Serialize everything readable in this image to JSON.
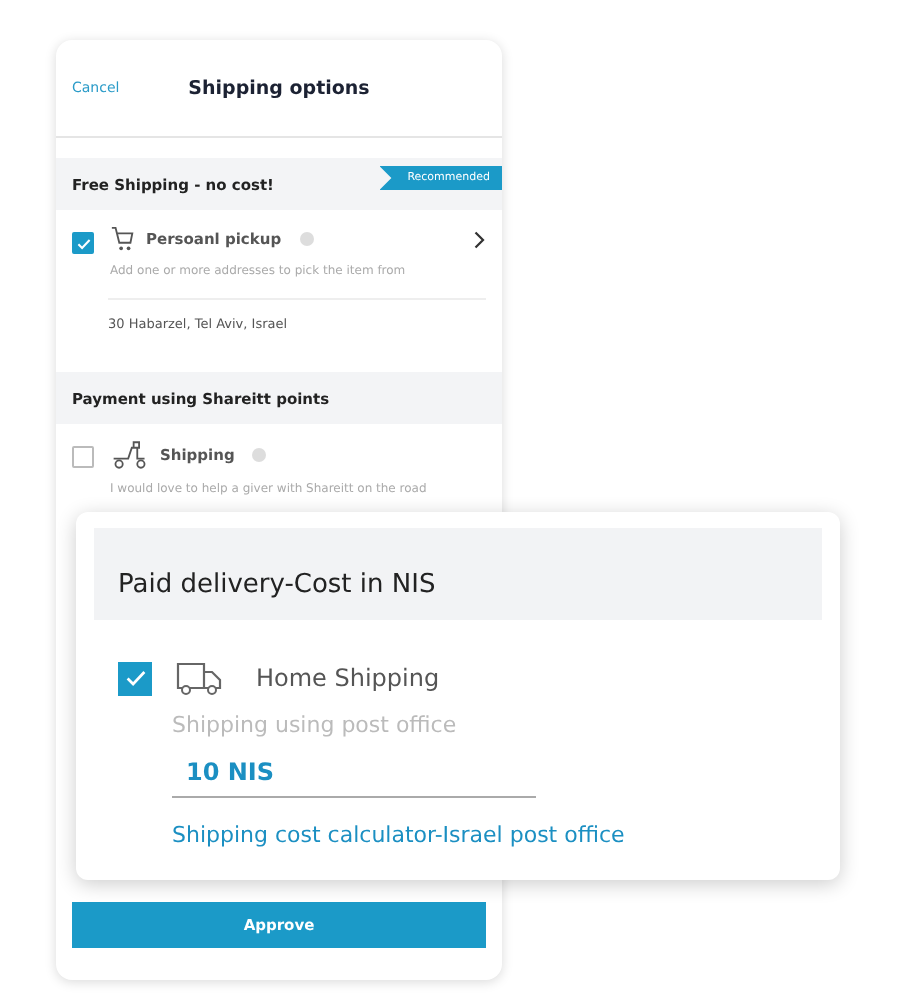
{
  "header": {
    "cancel": "Cancel",
    "title": "Shipping options"
  },
  "sections": [
    {
      "title": "Free Shipping - no cost!",
      "badge": "Recommended",
      "options": [
        {
          "kind": "pickup",
          "name": "Persoanl pickup",
          "description": "Add one or more addresses to pick the item from",
          "checked": true,
          "address": "30 Habarzel, Tel Aviv, Israel"
        }
      ]
    },
    {
      "title": "Payment using Shareitt points",
      "options": [
        {
          "kind": "scooter",
          "name": "Shipping",
          "description": "I would love to help a giver with Shareitt on the road",
          "checked": false
        }
      ]
    }
  ],
  "paid_card": {
    "title": "Paid delivery-Cost in NIS",
    "option": {
      "kind": "truck",
      "name": "Home Shipping",
      "checked": true,
      "description": "Shipping using post office",
      "cost": "10 NIS",
      "link": "Shipping cost calculator-Israel post office"
    }
  },
  "approve": "Approve"
}
